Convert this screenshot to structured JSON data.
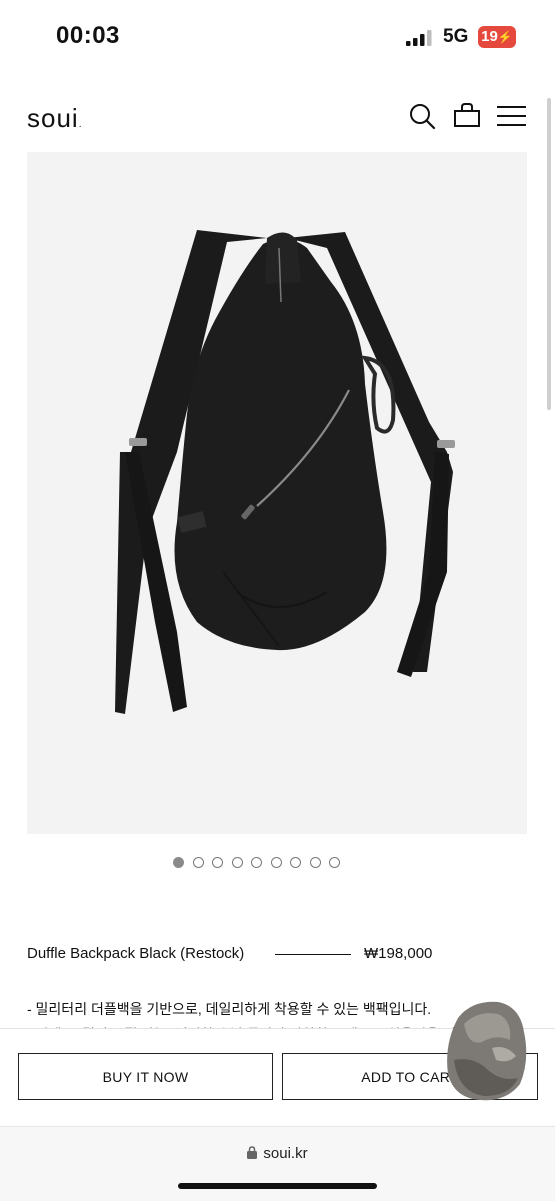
{
  "status_bar": {
    "time": "00:03",
    "network": "5G",
    "battery": "19"
  },
  "header": {
    "logo": "soui",
    "logo_dot": "."
  },
  "icons": {
    "search": "search-icon",
    "cart": "shopping-bag-icon",
    "menu": "hamburger-menu-icon"
  },
  "gallery": {
    "total_images": 9,
    "active_index": 0
  },
  "product": {
    "name": "Duffle Backpack Black (Restock)",
    "price": "₩198,000",
    "description_line1": "- 밀리터리 더플백을 기반으로, 데일리하게 착용할 수 있는 백팩입니다.",
    "description_line2": "- 어깨 끈 길이 조절 가능, 넉넉한 수납 공간과 다양한 포켓으로 실용성을 더했습니다."
  },
  "actions": {
    "buy_now": "BUY IT NOW",
    "add_to_cart": "ADD TO CART"
  },
  "browser": {
    "url": "soui.kr"
  },
  "colors": {
    "battery": "#e5483c",
    "bag": "#1d1d1d",
    "background": "#ffffff"
  }
}
